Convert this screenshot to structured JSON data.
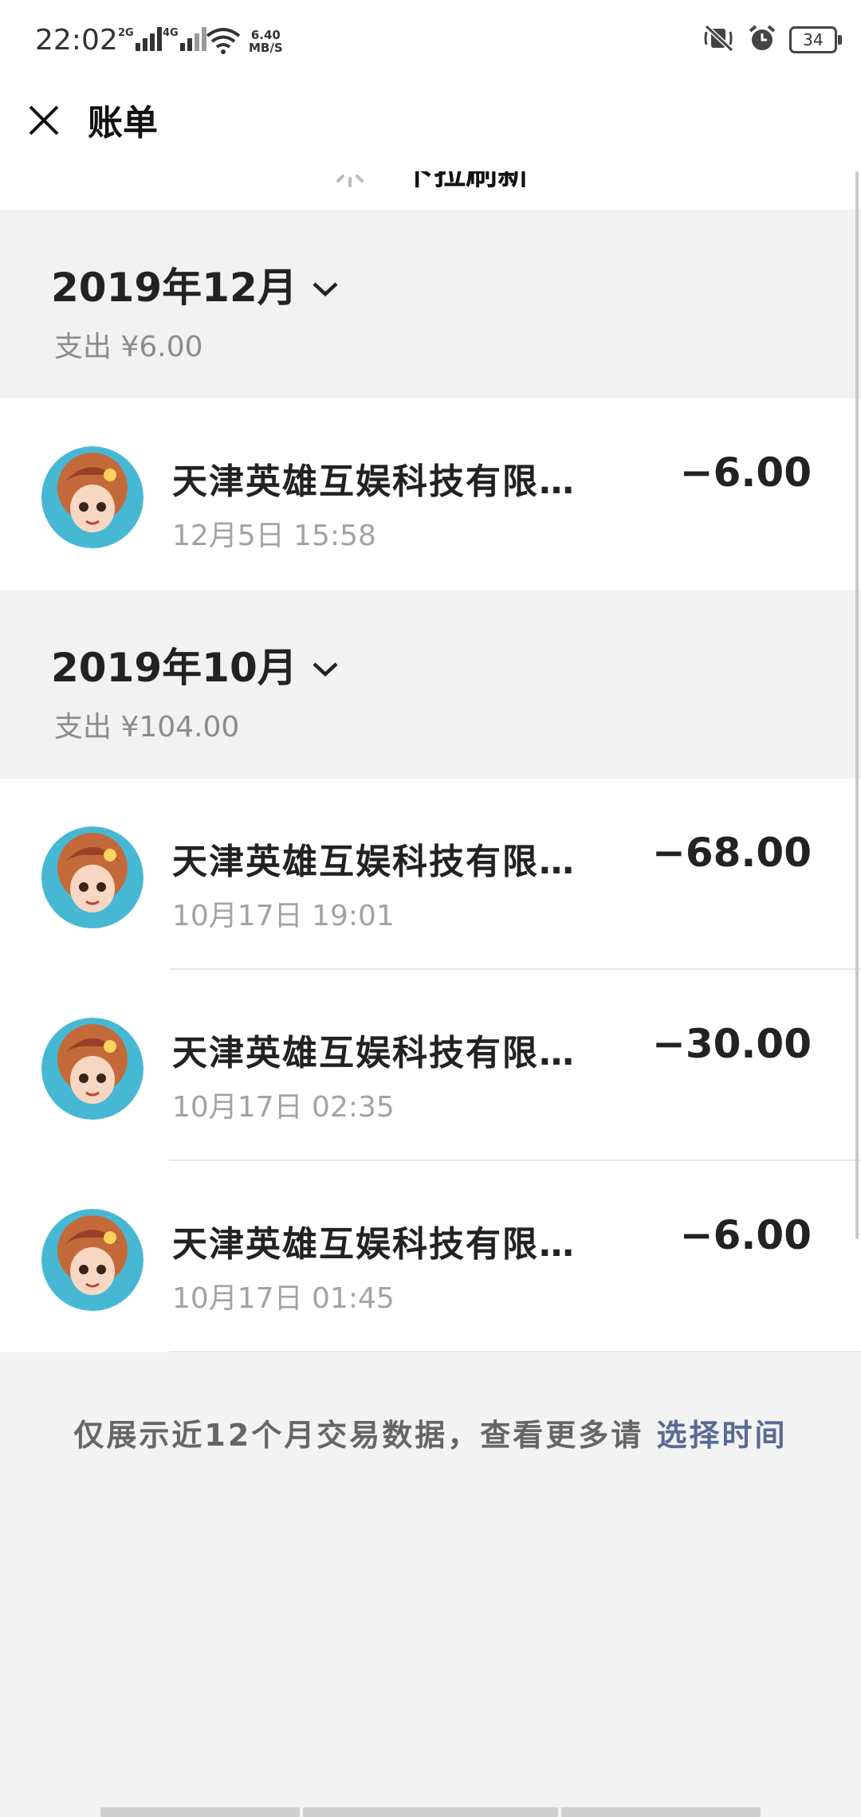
{
  "status_bar": {
    "time": "22:02",
    "network1": "2G",
    "network2": "4G",
    "speed_value": "6.40",
    "speed_unit": "MB/S",
    "battery": "34"
  },
  "header": {
    "title": "账单"
  },
  "pull_refresh": {
    "text": "下拉刷新"
  },
  "months": [
    {
      "title": "2019年12月",
      "summary": "支出 ¥6.00",
      "transactions": [
        {
          "name": "天津英雄互娱科技有限…",
          "time": "12月5日 15:58",
          "amount": "−6.00"
        }
      ]
    },
    {
      "title": "2019年10月",
      "summary": "支出 ¥104.00",
      "transactions": [
        {
          "name": "天津英雄互娱科技有限…",
          "time": "10月17日 19:01",
          "amount": "−68.00"
        },
        {
          "name": "天津英雄互娱科技有限…",
          "time": "10月17日 02:35",
          "amount": "−30.00"
        },
        {
          "name": "天津英雄互娱科技有限…",
          "time": "10月17日 01:45",
          "amount": "−6.00"
        }
      ]
    }
  ],
  "footer": {
    "text": "仅展示近12个月交易数据，查看更多请",
    "link": "选择时间"
  },
  "colors": {
    "link": "#576b95",
    "page_bg": "#f3f3f3"
  },
  "icons": [
    "close-icon",
    "chevron-down-icon",
    "spinner-icon",
    "avatar-image",
    "wifi-icon",
    "mute-icon",
    "alarm-icon",
    "battery-icon"
  ]
}
